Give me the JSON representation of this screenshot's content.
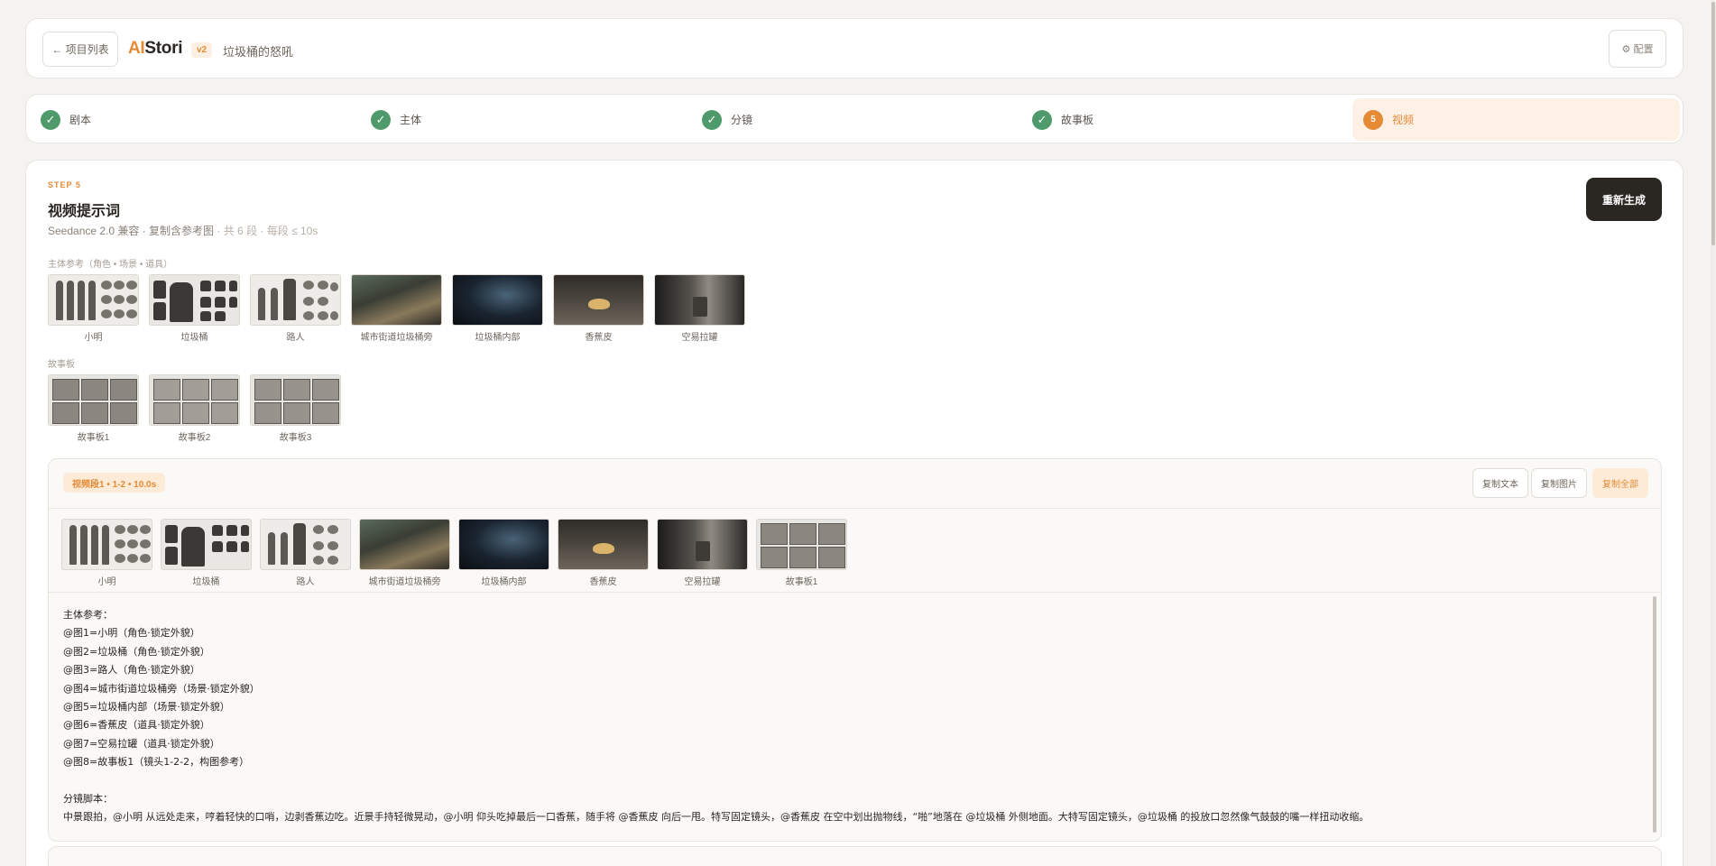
{
  "header": {
    "back_label": "← 项目列表",
    "logo_ai": "AI",
    "logo_rest": "Stori",
    "version": "v2",
    "project_title": "垃圾桶的怒吼",
    "config_label": "⚙ 配置"
  },
  "steps": [
    {
      "icon": "✓",
      "label": "剧本",
      "state": "done"
    },
    {
      "icon": "✓",
      "label": "主体",
      "state": "done"
    },
    {
      "icon": "✓",
      "label": "分镜",
      "state": "done"
    },
    {
      "icon": "✓",
      "label": "故事板",
      "state": "done"
    },
    {
      "icon": "5",
      "label": "视频",
      "state": "active"
    }
  ],
  "main": {
    "step_label": "STEP 5",
    "title": "视频提示词",
    "subtitle": "Seedance 2.0 兼容 · 复制含参考图",
    "subtitle_muted": " · 共 6 段 · 每段 ≤ 10s",
    "regen_label": "重新生成",
    "subject_refs_label": "主体参考（角色 • 场景 • 道具）",
    "subject_refs": [
      "小明",
      "垃圾桶",
      "路人",
      "城市街道垃圾桶旁",
      "垃圾桶内部",
      "香蕉皮",
      "空易拉罐"
    ],
    "storyboard_label": "故事板",
    "storyboards": [
      "故事板1",
      "故事板2",
      "故事板3"
    ]
  },
  "segment": {
    "badge": "视频段1 • 1-2 • 10.0s",
    "copy_text": "复制文本",
    "copy_images": "复制图片",
    "copy_all": "复制全部",
    "thumbs": [
      "小明",
      "垃圾桶",
      "路人",
      "城市街道垃圾桶旁",
      "垃圾桶内部",
      "香蕉皮",
      "空易拉罐",
      "故事板1"
    ],
    "prompt": "主体参考：\n@图1=小明（角色·锁定外貌）\n@图2=垃圾桶（角色·锁定外貌）\n@图3=路人（角色·锁定外貌）\n@图4=城市街道垃圾桶旁（场景·锁定外貌）\n@图5=垃圾桶内部（场景·锁定外貌）\n@图6=香蕉皮（道具·锁定外貌）\n@图7=空易拉罐（道具·锁定外貌）\n@图8=故事板1（镜头1-2-2，构图参考）\n\n分镜脚本：\n中景跟拍，@小明 从远处走来，哼着轻快的口哨，边剥香蕉边吃。近景手持轻微晃动，@小明 仰头吃掉最后一口香蕉，随手将 @香蕉皮 向后一甩。特写固定镜头，@香蕉皮 在空中划出抛物线，“啪”地落在 @垃圾桶 外侧地面。大特写固定镜头，@垃圾桶 的投放口忽然像气鼓鼓的嘴一样扭动收缩。"
  },
  "colors": {
    "accent": "#e58a35",
    "done": "#4f9a6a",
    "dark_button": "#2a2622"
  }
}
